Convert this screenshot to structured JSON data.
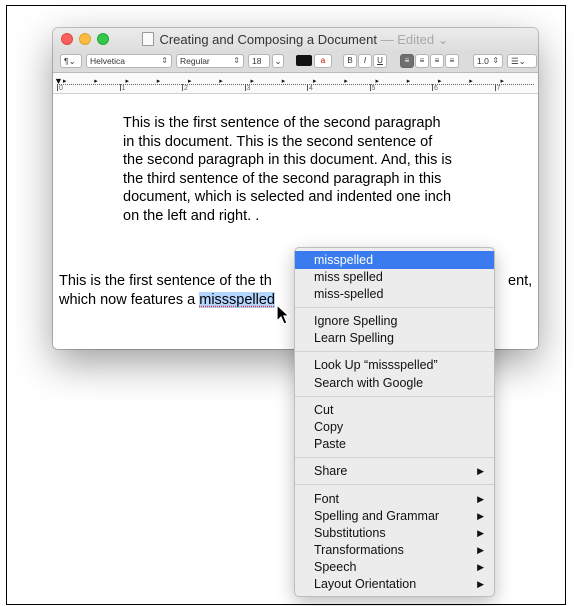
{
  "window": {
    "title": "Creating and Composing a Document",
    "edited_status": "— Edited ⌄"
  },
  "toolbar": {
    "paragraph_style": "¶⌄",
    "font_family": "Helvetica",
    "font_style": "Regular",
    "font_size": "18",
    "bold": "B",
    "italic": "I",
    "underline": "U",
    "line_spacing": "1.0",
    "list_style": "☰⌄"
  },
  "ruler": {
    "numbers": [
      "0",
      "1",
      "2",
      "3",
      "4",
      "5",
      "6",
      "7"
    ]
  },
  "document": {
    "paragraph2": "This is the first sentence of the second paragraph in this document. This is the second sentence of the second paragraph in this document. And, this is the third sentence of the second paragraph in this document, which is selected and indented one inch on the left and right. .",
    "paragraph3_start": "This is the first sentence of the th",
    "paragraph3_line2_prefix": "which now features a ",
    "selected_word": "missspelled",
    "paragraph3_end_visible": "ent,"
  },
  "context_menu": {
    "suggestions": [
      "misspelled",
      "miss spelled",
      "miss-spelled"
    ],
    "ignore_spelling": "Ignore Spelling",
    "learn_spelling": "Learn Spelling",
    "look_up": "Look Up “missspelled”",
    "search_google": "Search with Google",
    "cut": "Cut",
    "copy": "Copy",
    "paste": "Paste",
    "share": "Share",
    "font": "Font",
    "spelling_grammar": "Spelling and Grammar",
    "substitutions": "Substitutions",
    "transformations": "Transformations",
    "speech": "Speech",
    "layout_orientation": "Layout Orientation",
    "submenu_arrow": "▶"
  },
  "colors": {
    "highlight": "#3a7bf0",
    "selection": "#b4d5fe",
    "close": "#fc605c",
    "minimize": "#fdbc40",
    "maximize": "#34c84a"
  }
}
